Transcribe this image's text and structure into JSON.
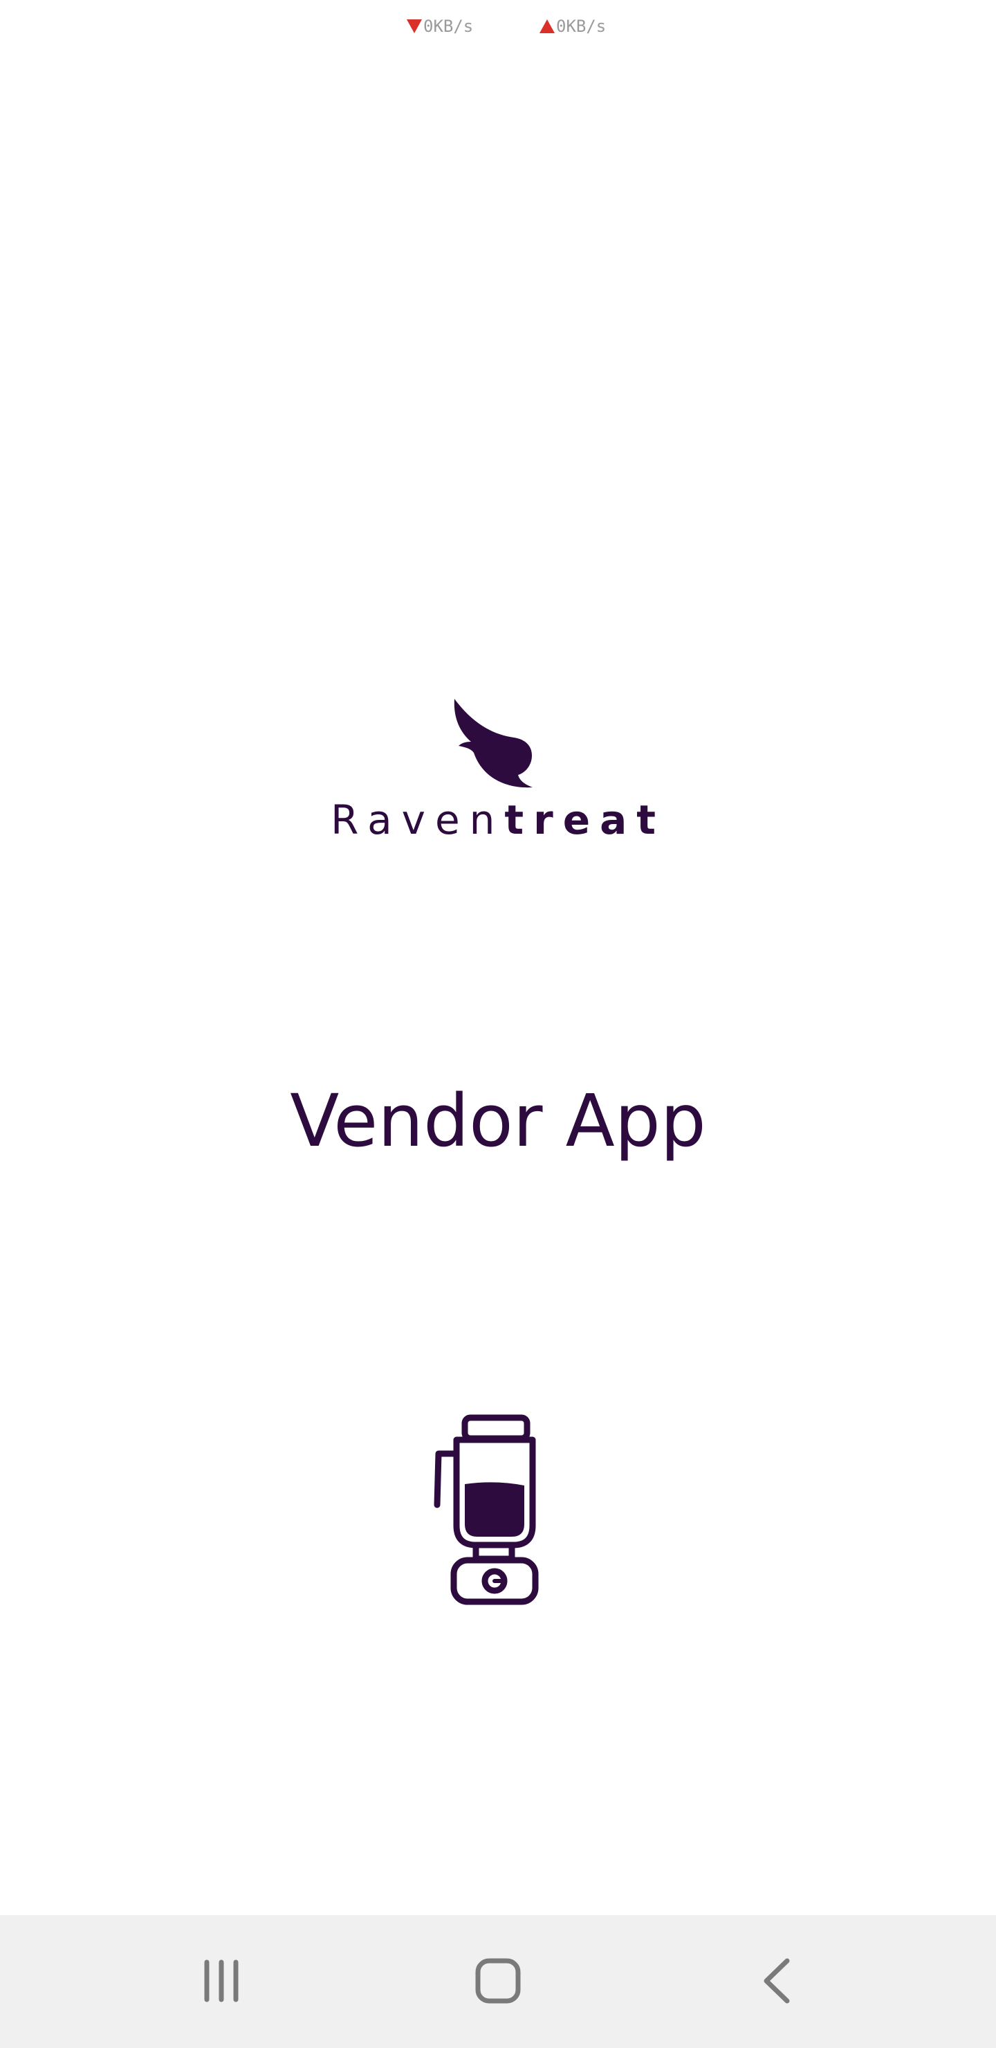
{
  "status_bar": {
    "download_speed": "0KB/s",
    "upload_speed": "0KB/s",
    "arrow_color": "#d9302a"
  },
  "brand": {
    "name_light": "Raven",
    "name_bold": "treat",
    "logo_icon": "raven-wing-icon",
    "color": "#2e0b3f"
  },
  "app": {
    "title": "Vendor App",
    "illustration_icon": "blender-icon"
  },
  "nav_bar": {
    "recent_icon": "recent-apps-icon",
    "home_icon": "home-icon",
    "back_icon": "back-icon",
    "background": "#f0f0f0"
  }
}
